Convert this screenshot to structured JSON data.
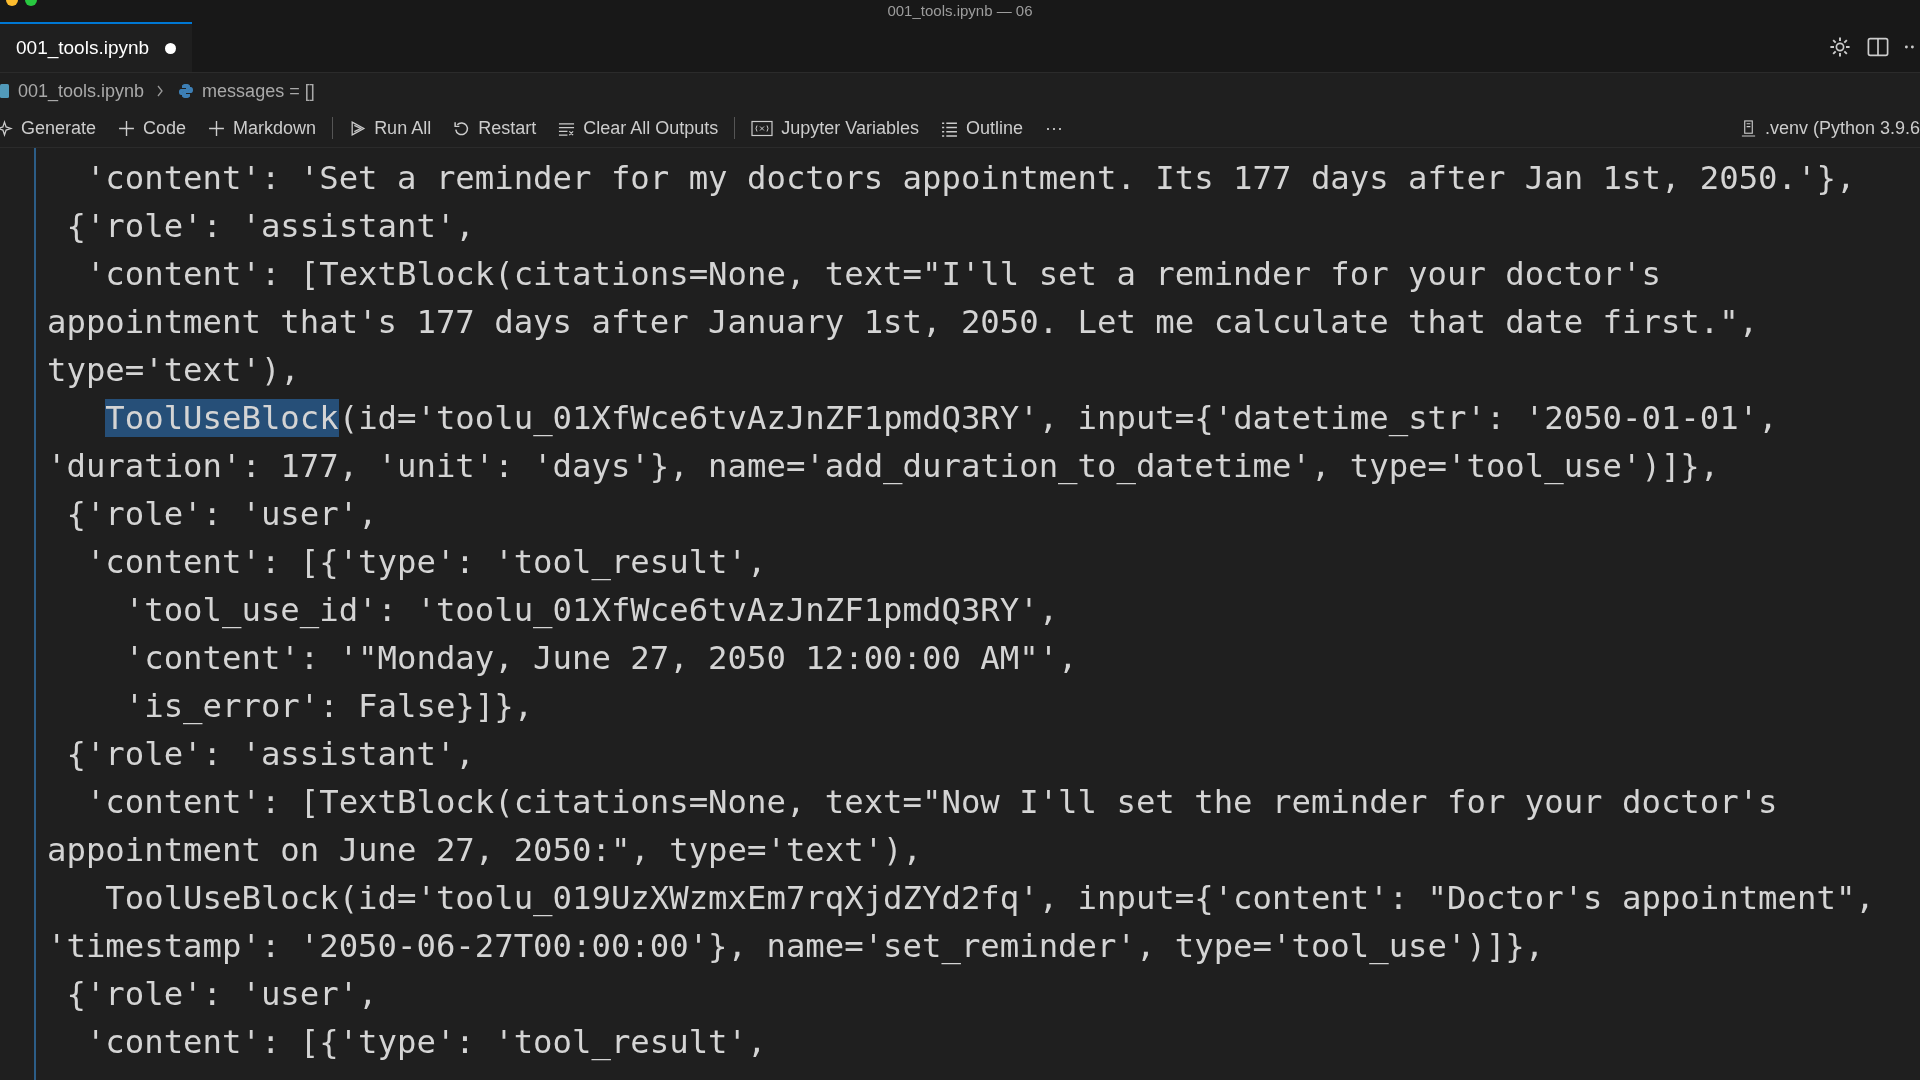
{
  "window": {
    "title": "001_tools.ipynb — 06"
  },
  "tabs": [
    {
      "label": "001_tools.ipynb",
      "selected": true,
      "modified": true
    }
  ],
  "breadcrumb": [
    "001_tools.ipynb",
    "messages = []"
  ],
  "toolbar": [
    {
      "kind": "sparkle",
      "label": "Generate"
    },
    {
      "kind": "plus",
      "label": "Code"
    },
    {
      "kind": "plus",
      "label": "Markdown"
    },
    {
      "kind": "separator"
    },
    {
      "kind": "run",
      "label": "Run All"
    },
    {
      "kind": "restart",
      "label": "Restart"
    },
    {
      "kind": "clear",
      "label": "Clear All Outputs"
    },
    {
      "kind": "separator"
    },
    {
      "kind": "variables",
      "label": "Jupyter Variables"
    },
    {
      "kind": "outline",
      "label": "Outline"
    },
    {
      "kind": "more",
      "label": "···"
    }
  ],
  "kernel": {
    "label": ".venv (Python 3.9.6"
  },
  "code_lines": [
    {
      "segments": [
        {
          "text": "  'content': 'Set a reminder for my doctors appointment. Its 177 days after Jan 1st, 2050.'},",
          "selected": false
        }
      ]
    },
    {
      "segments": [
        {
          "text": " {'role': 'assistant',",
          "selected": false
        }
      ]
    },
    {
      "segments": [
        {
          "text": "  'content': [TextBlock(citations=None, text=\"I'll set a reminder for your doctor's",
          "selected": false
        }
      ]
    },
    {
      "segments": [
        {
          "text": "appointment that's 177 days after January 1st, 2050. Let me calculate that date first.\",",
          "selected": false
        }
      ]
    },
    {
      "segments": [
        {
          "text": "type='text'),",
          "selected": false
        }
      ]
    },
    {
      "segments": [
        {
          "text": "   ToolUseBlock",
          "selected": true
        },
        {
          "text": "(id='toolu_01XfWce6tvAzJnZF1pmdQ3RY', input={'datetime_str': '2050-01-01',",
          "selected": false
        }
      ]
    },
    {
      "segments": [
        {
          "text": "'duration': 177, 'unit': 'days'}, name='add_duration_to_datetime', type='tool_use')]},",
          "selected": false
        }
      ]
    },
    {
      "segments": [
        {
          "text": " {'role': 'user',",
          "selected": false
        }
      ]
    },
    {
      "segments": [
        {
          "text": "  'content': [{'type': 'tool_result',",
          "selected": false
        }
      ]
    },
    {
      "segments": [
        {
          "text": "    'tool_use_id': 'toolu_01XfWce6tvAzJnZF1pmdQ3RY',",
          "selected": false
        }
      ]
    },
    {
      "segments": [
        {
          "text": "    'content': '\"Monday, June 27, 2050 12:00:00 AM\"',",
          "selected": false
        }
      ]
    },
    {
      "segments": [
        {
          "text": "    'is_error': False}]},",
          "selected": false
        }
      ]
    },
    {
      "segments": [
        {
          "text": " {'role': 'assistant',",
          "selected": false
        }
      ]
    },
    {
      "segments": [
        {
          "text": "  'content': [TextBlock(citations=None, text=\"Now I'll set the reminder for your doctor's",
          "selected": false
        }
      ]
    },
    {
      "segments": [
        {
          "text": "appointment on June 27, 2050:\", type='text'),",
          "selected": false
        }
      ]
    },
    {
      "segments": [
        {
          "text": "   ToolUseBlock(id='toolu_019UzXWzmxEm7rqXjdZYd2fq', input={'content': \"Doctor's appointment\",",
          "selected": false
        }
      ]
    },
    {
      "segments": [
        {
          "text": "'timestamp': '2050-06-27T00:00:00'}, name='set_reminder', type='tool_use')]},",
          "selected": false
        }
      ]
    },
    {
      "segments": [
        {
          "text": " {'role': 'user',",
          "selected": false
        }
      ]
    },
    {
      "segments": [
        {
          "text": "  'content': [{'type': 'tool_result',",
          "selected": false
        }
      ]
    }
  ]
}
